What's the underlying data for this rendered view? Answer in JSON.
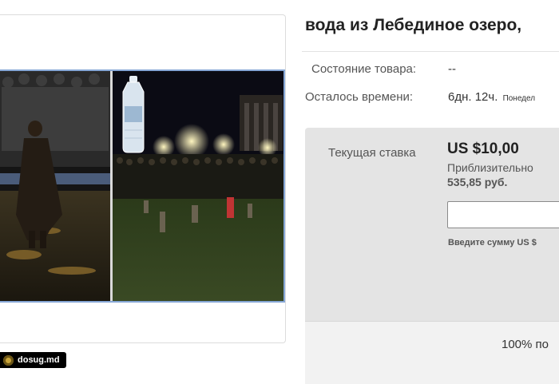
{
  "listing": {
    "title": "вода из Лебединое озеро,",
    "condition_label": "Состояние товара:",
    "condition_value": "--",
    "time_left_label": "Осталось времени:",
    "time_left_value": "6дн. 12ч.",
    "time_left_sub": "Понедел"
  },
  "bid": {
    "label": "Текущая ставка",
    "price": "US $10,00",
    "approx_label": "Приблизительно",
    "approx_value": "535,85 руб.",
    "input_value": "",
    "hint": "Введите сумму US $"
  },
  "seller": {
    "feedback": "100% по"
  },
  "watermark": {
    "text": "dosug.md"
  },
  "colors": {
    "photo_border": "#86a7d6",
    "bid_panel": "#e4e4e4"
  }
}
